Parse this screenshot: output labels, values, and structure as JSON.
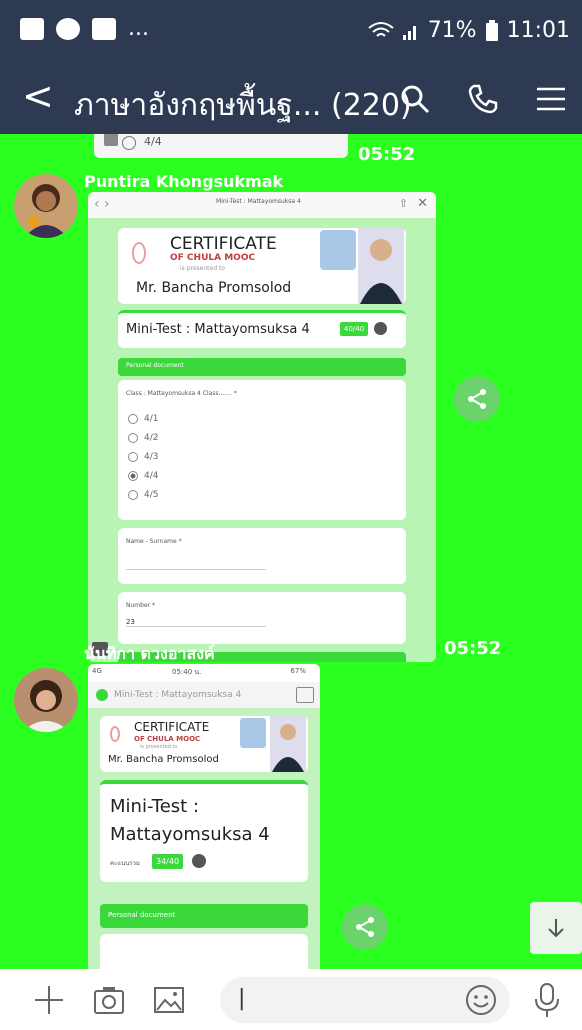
{
  "status": {
    "battery_percent": "71%",
    "time": "11:01",
    "dots": "..."
  },
  "header": {
    "back_symbol": "<",
    "title": "ภาษาอังกฤษพื้นฐ... (220)"
  },
  "messages": [
    {
      "type": "partial",
      "option_text": "4/4",
      "time": "05:52"
    },
    {
      "sender": "Puntira Khongsukmak",
      "time": "05:52",
      "shot": {
        "url_bar_title": "Mini-Test : Mattayomsuksa 4",
        "certificate": "CERTIFICATE",
        "of": "OF CHULA MOOC",
        "presented": "is presented to",
        "name": "Mr. Bancha Promsolod",
        "test_title": "Mini-Test : Mattayomsuksa 4",
        "score": "40/40",
        "section": "Personal document",
        "class_label": "Class : Mattayomsuksa 4 Class....... *",
        "options": [
          "4/1",
          "4/2",
          "4/3",
          "4/4",
          "4/5"
        ],
        "selected_index": 3,
        "name_label": "Name - Surname *",
        "number_label": "Number *",
        "number_value": "23"
      }
    },
    {
      "sender": "นันทิกา ดวงอาสงค์",
      "shot": {
        "status_left": "4G",
        "status_time": "05:40 น.",
        "status_right": "67%",
        "url_title": "Mini-Test : Mattayomsuksa 4",
        "certificate": "CERTIFICATE",
        "of": "OF CHULA MOOC",
        "presented": "is presented to",
        "name": "Mr. Bancha Promsolod",
        "test_title_1": "Mini-Test :",
        "test_title_2": "Mattayomsuksa 4",
        "score_label": "คะแนนรวม",
        "score": "34/40",
        "section": "Personal document"
      }
    }
  ],
  "composer": {
    "input_value": "|"
  }
}
